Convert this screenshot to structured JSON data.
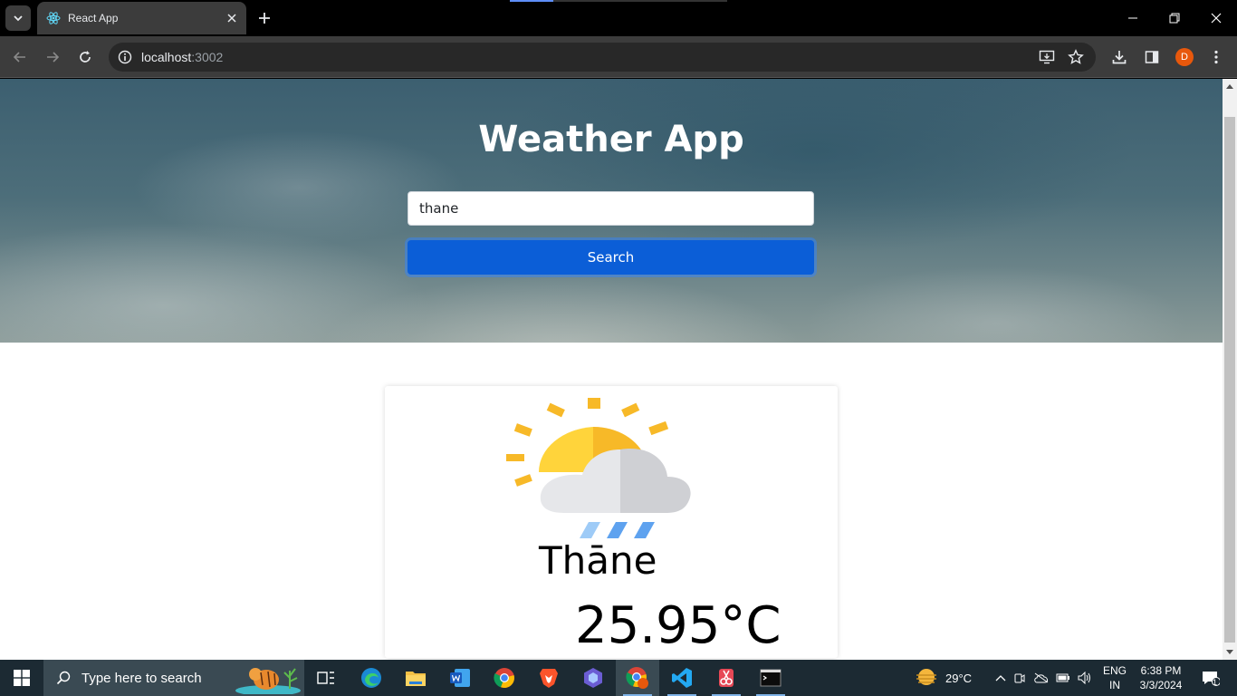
{
  "browser": {
    "tab_title": "React App",
    "url_host": "localhost",
    "url_port": ":3002",
    "profile_initial": "D"
  },
  "page": {
    "app_title": "Weather App",
    "search_value": "thane",
    "search_button": "Search",
    "city": "Thāne",
    "temperature": "25.95°C"
  },
  "taskbar": {
    "search_placeholder": "Type here to search",
    "weather_temp": "29°C",
    "lang_top": "ENG",
    "lang_bottom": "IN",
    "time": "6:38 PM",
    "date": "3/3/2024",
    "notification_count": "1"
  },
  "colors": {
    "button_blue": "#0b5ed7",
    "chrome_dark": "#3c3c3c",
    "taskbar": "#1c2a33"
  }
}
